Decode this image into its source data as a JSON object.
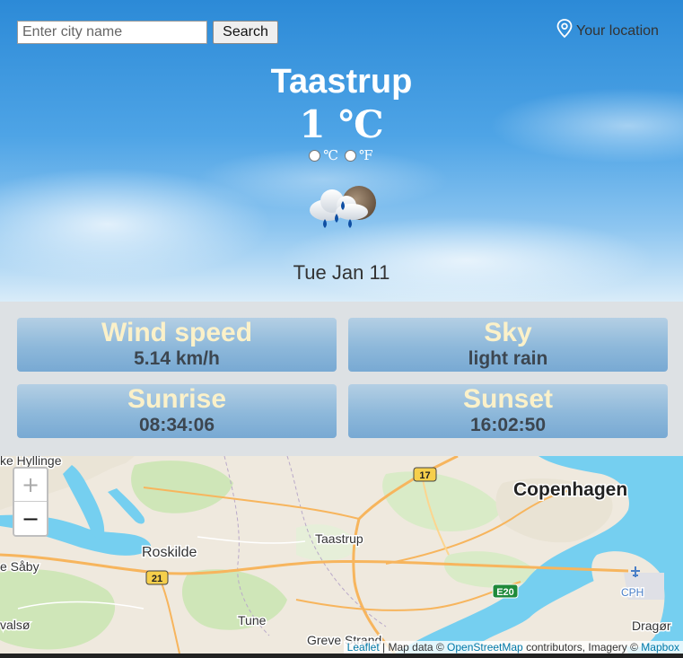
{
  "search": {
    "placeholder": "Enter city name",
    "button_label": "Search"
  },
  "location": {
    "label": "Your location",
    "icon": "location-pin-icon"
  },
  "weather": {
    "city": "Taastrup",
    "temperature": "1 ℃",
    "units": [
      "℃",
      "℉"
    ],
    "icon": "rain-cloud-moon-icon",
    "date": "Tue Jan 11"
  },
  "cards": [
    {
      "title": "Wind speed",
      "value": "5.14 km/h"
    },
    {
      "title": "Sky",
      "value": "light rain"
    },
    {
      "title": "Sunrise",
      "value": "08:34:06"
    },
    {
      "title": "Sunset",
      "value": "16:02:50"
    }
  ],
  "map": {
    "zoom_in": "+",
    "zoom_out": "−",
    "labels": {
      "hyllinge": "ke Hyllinge",
      "copenhagen": "Copenhagen",
      "roskilde": "Roskilde",
      "taastrup": "Taastrup",
      "saby": "e Såby",
      "valso": "valsø",
      "tune": "Tune",
      "greve": "Greve Strand",
      "cph": "CPH",
      "dragor": "Dragør",
      "road17": "17",
      "road21": "21",
      "roadE20": "E20"
    },
    "attribution": {
      "leaflet": "Leaflet",
      "sep": " | Map data © ",
      "osm": "OpenStreetMap",
      "middle": " contributors, Imagery © ",
      "mapbox": "Mapbox"
    }
  },
  "colors": {
    "card_title": "#fbf1c9",
    "card_value": "#3c4650",
    "cards_bg": "#dde1e4",
    "water": "#75cff0",
    "green": "#cfe6b8",
    "road": "#f7b55d"
  }
}
